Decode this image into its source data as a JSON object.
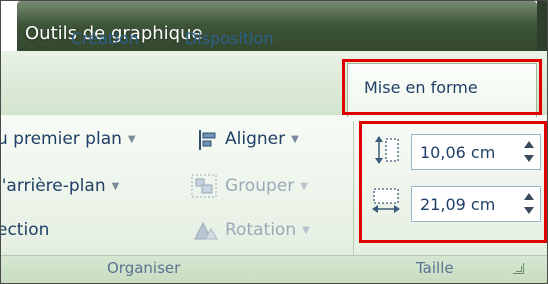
{
  "context_group": {
    "title": "Outils de graphique"
  },
  "tabs": [
    {
      "label": "Création"
    },
    {
      "label": "Disposition"
    },
    {
      "label": "Mise en forme",
      "active": true
    }
  ],
  "organiser": {
    "label": "Organiser",
    "items": [
      {
        "label": "u premier plan",
        "icon": "bring-forward-icon",
        "has_dropdown": true
      },
      {
        "label": "l'arrière-plan",
        "icon": "send-backward-icon",
        "has_dropdown": true
      },
      {
        "label": "ection",
        "icon": "selection-pane-icon"
      },
      {
        "label": "Aligner",
        "icon": "align-icon",
        "has_dropdown": true,
        "enabled": true
      },
      {
        "label": "Grouper",
        "icon": "group-icon",
        "has_dropdown": true,
        "enabled": false
      },
      {
        "label": "Rotation",
        "icon": "rotate-icon",
        "has_dropdown": true,
        "enabled": false
      }
    ]
  },
  "taille": {
    "label": "Taille",
    "height": {
      "value": "10,06 cm",
      "icon": "shape-height-icon"
    },
    "width": {
      "value": "21,09 cm",
      "icon": "shape-width-icon"
    }
  },
  "colors": {
    "context_header": "#3b5236",
    "highlight": "#e00000",
    "text": "#1f3f66"
  }
}
